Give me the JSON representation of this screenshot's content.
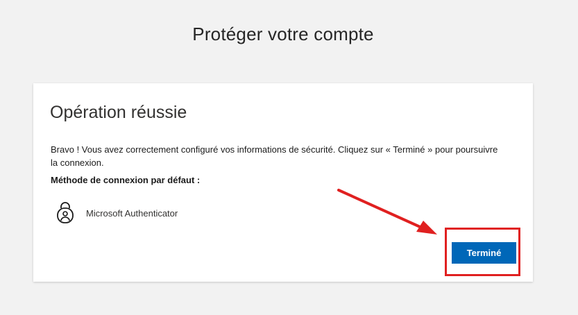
{
  "header": {
    "title": "Protéger votre compte"
  },
  "card": {
    "title": "Opération réussie",
    "message": "Bravo ! Vous avez correctement configuré vos informations de sécurité. Cliquez sur « Terminé » pour poursuivre la connexion.",
    "default_method_heading": "Méthode de connexion par défaut :",
    "method": {
      "icon": "authenticator-lock-icon",
      "label": "Microsoft Authenticator"
    },
    "done_button_label": "Terminé"
  },
  "annotation": {
    "arrow_color": "#e02020",
    "highlight_color": "#e02020"
  },
  "colors": {
    "accent": "#0067b8",
    "background": "#f2f2f2"
  }
}
